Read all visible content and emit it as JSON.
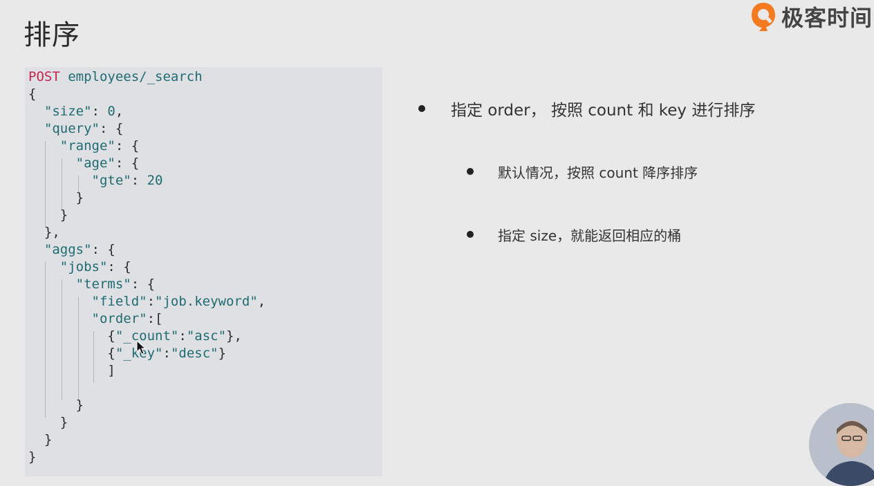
{
  "slide": {
    "title": "排序"
  },
  "brand": {
    "name": "极客时间",
    "accent": "#f47a20"
  },
  "code": {
    "method": "POST",
    "path": "employees/_search",
    "size_key": "\"size\"",
    "size_val": "0",
    "query_key": "\"query\"",
    "range_key": "\"range\"",
    "age_key": "\"age\"",
    "gte_key": "\"gte\"",
    "gte_val": "20",
    "aggs_key": "\"aggs\"",
    "jobs_key": "\"jobs\"",
    "terms_key": "\"terms\"",
    "field_key": "\"field\"",
    "field_val": "\"job.keyword\"",
    "order_key": "\"order\"",
    "count_key": "\"_count\"",
    "asc_val": "\"asc\"",
    "key_key": "\"_key\"",
    "desc_val": "\"desc\""
  },
  "bullets": [
    {
      "text": "指定 order， 按照 count 和 key 进行排序"
    },
    {
      "text": "默认情况，按照 count 降序排序"
    },
    {
      "text": "指定 size，就能返回相应的桶"
    }
  ],
  "colors": {
    "keyword": "#c7254e",
    "string": "#1f6b72"
  }
}
